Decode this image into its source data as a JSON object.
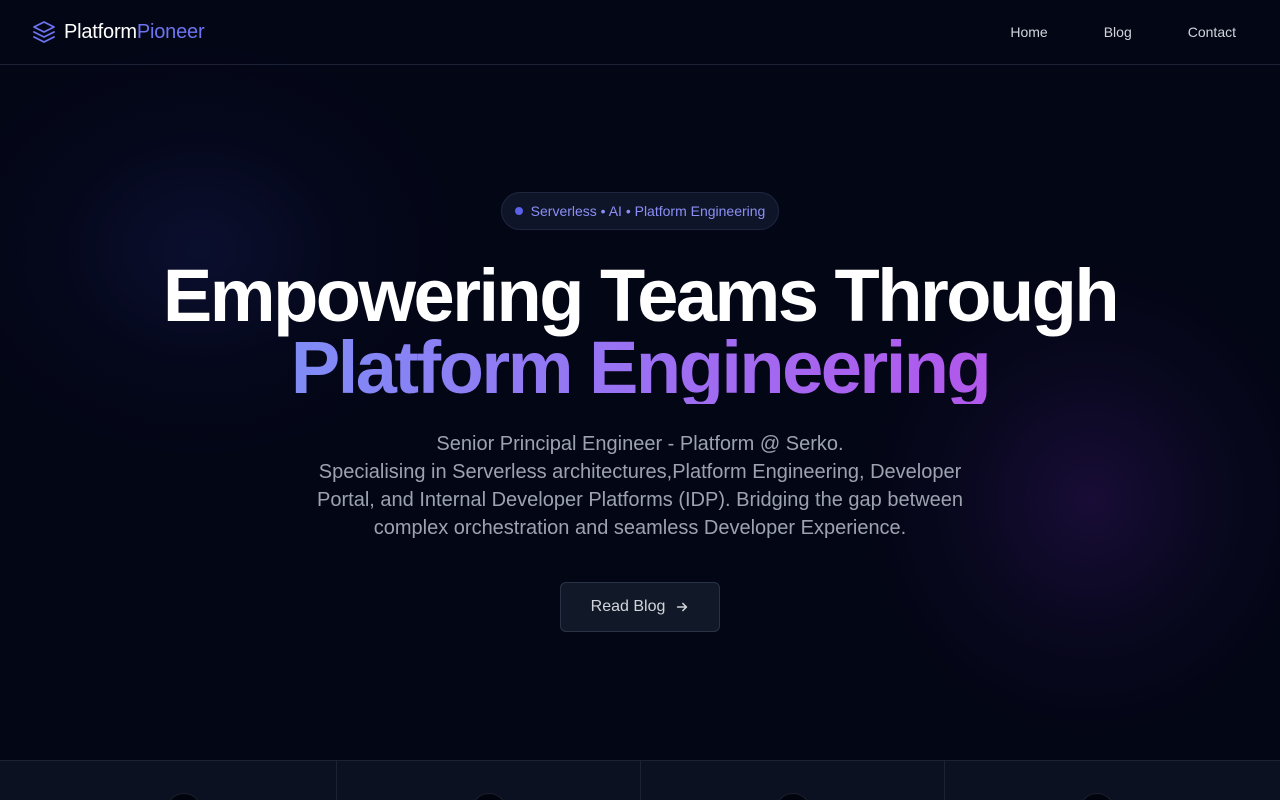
{
  "brand": {
    "name_part1": "Platform",
    "name_part2": "Pioneer",
    "accent": "#6d74f0"
  },
  "nav": {
    "items": [
      {
        "label": "Home"
      },
      {
        "label": "Blog"
      },
      {
        "label": "Contact"
      }
    ]
  },
  "hero": {
    "badge": "Serverless • AI • Platform Engineering",
    "title_line1": "Empowering Teams Through",
    "title_line2": "Platform Engineering",
    "subtitle_line1": "Senior Principal Engineer - Platform @ Serko.",
    "subtitle_line2": "Specialising in Serverless architectures,Platform Engineering, Developer Portal, and Internal Developer Platforms (IDP). Bridging the gap between complex orchestration and seamless Developer Experience.",
    "cta_label": "Read Blog"
  },
  "colors": {
    "background": "#030615",
    "gradient_start": "#7f8cf6",
    "gradient_end": "#b258ec"
  },
  "icons": {
    "brand": "layers-icon",
    "cta": "arrow-right-icon"
  }
}
